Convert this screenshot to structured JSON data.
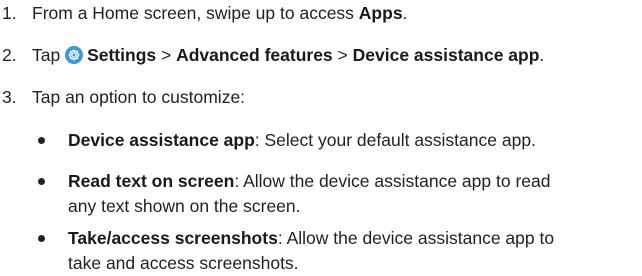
{
  "steps": [
    {
      "num": "1.",
      "pre": "From a Home screen, swipe up to access ",
      "bold": "Apps",
      "post": "."
    },
    {
      "num": "2.",
      "pre": "Tap ",
      "icon": "settings-gear-icon",
      "b1": "Settings",
      "sep1": " > ",
      "b2": "Advanced features",
      "sep2": " > ",
      "b3": "Device assistance app",
      "post": "."
    },
    {
      "num": "3.",
      "text": "Tap an option to customize:"
    }
  ],
  "options": [
    {
      "term": "Device assistance app",
      "line1": ": Select your default assistance app.",
      "line2": ""
    },
    {
      "term": "Read text on screen",
      "line1": ": Allow the device assistance app to read",
      "line2": "any text shown on the screen."
    },
    {
      "term": "Take/access screenshots",
      "line1": ": Allow the device assistance app to",
      "line2": "take and access screenshots."
    }
  ],
  "colors": {
    "icon_bg": "#3d9ad6",
    "text": "#222222"
  }
}
